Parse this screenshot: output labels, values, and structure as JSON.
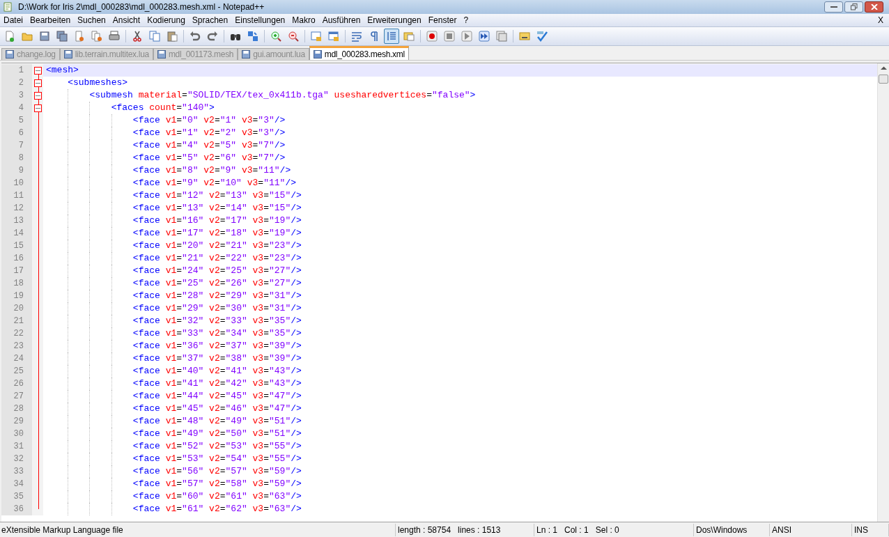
{
  "window": {
    "title": "D:\\Work for Iris 2\\mdl_000283\\mdl_000283.mesh.xml - Notepad++"
  },
  "menu": [
    "Datei",
    "Bearbeiten",
    "Suchen",
    "Ansicht",
    "Kodierung",
    "Sprachen",
    "Einstellungen",
    "Makro",
    "Ausführen",
    "Erweiterungen",
    "Fenster",
    "?"
  ],
  "menu_close": "X",
  "toolbar": [
    {
      "kind": "new"
    },
    {
      "kind": "open"
    },
    {
      "kind": "save"
    },
    {
      "kind": "saveall"
    },
    {
      "kind": "close"
    },
    {
      "kind": "closeall"
    },
    {
      "kind": "print"
    },
    {
      "kind": "sep"
    },
    {
      "kind": "cut"
    },
    {
      "kind": "copy"
    },
    {
      "kind": "paste"
    },
    {
      "kind": "sep"
    },
    {
      "kind": "undo"
    },
    {
      "kind": "redo"
    },
    {
      "kind": "sep"
    },
    {
      "kind": "find"
    },
    {
      "kind": "replace"
    },
    {
      "kind": "sep"
    },
    {
      "kind": "zoomin"
    },
    {
      "kind": "zoomout"
    },
    {
      "kind": "sep"
    },
    {
      "kind": "syncv"
    },
    {
      "kind": "synch"
    },
    {
      "kind": "sep"
    },
    {
      "kind": "wrap",
      "pressed": false
    },
    {
      "kind": "pilcrow",
      "pressed": false
    },
    {
      "kind": "indent",
      "pressed": true
    },
    {
      "kind": "folder",
      "pressed": false
    },
    {
      "kind": "sep"
    },
    {
      "kind": "record"
    },
    {
      "kind": "stop"
    },
    {
      "kind": "play"
    },
    {
      "kind": "playmulti"
    },
    {
      "kind": "savemacro"
    },
    {
      "kind": "sep"
    },
    {
      "kind": "link"
    },
    {
      "kind": "spell"
    }
  ],
  "tabs": [
    {
      "label": "change.log",
      "selected": false
    },
    {
      "label": "lib.terrain.multitex.lua",
      "selected": false
    },
    {
      "label": "mdl_001173.mesh",
      "selected": false
    },
    {
      "label": "gui.amount.lua",
      "selected": false
    },
    {
      "label": "mdl_000283.mesh.xml",
      "selected": true
    }
  ],
  "editor": {
    "lines": [
      {
        "number": "1",
        "text": "<mesh>",
        "expanded": true,
        "current": true
      },
      {
        "number": "2",
        "text": "    <submeshes>",
        "expanded": true,
        "current": false
      },
      {
        "number": "3",
        "text": "        <submesh material=\"SOLID/TEX/tex_0x411b.tga\" usesharedvertices=\"false\">",
        "expanded": true,
        "current": false
      },
      {
        "number": "4",
        "text": "            <faces count=\"140\">",
        "expanded": true,
        "current": false
      },
      {
        "number": "5",
        "text": "                <face v1=\"0\" v2=\"1\" v3=\"3\"/>",
        "current": false
      },
      {
        "number": "6",
        "text": "                <face v1=\"1\" v2=\"2\" v3=\"3\"/>",
        "current": false
      },
      {
        "number": "7",
        "text": "                <face v1=\"4\" v2=\"5\" v3=\"7\"/>",
        "current": false
      },
      {
        "number": "8",
        "text": "                <face v1=\"5\" v2=\"6\" v3=\"7\"/>",
        "current": false
      },
      {
        "number": "9",
        "text": "                <face v1=\"8\" v2=\"9\" v3=\"11\"/>",
        "current": false
      },
      {
        "number": "10",
        "text": "                <face v1=\"9\" v2=\"10\" v3=\"11\"/>",
        "current": false
      },
      {
        "number": "11",
        "text": "                <face v1=\"12\" v2=\"13\" v3=\"15\"/>",
        "current": false
      },
      {
        "number": "12",
        "text": "                <face v1=\"13\" v2=\"14\" v3=\"15\"/>",
        "current": false
      },
      {
        "number": "13",
        "text": "                <face v1=\"16\" v2=\"17\" v3=\"19\"/>",
        "current": false
      },
      {
        "number": "14",
        "text": "                <face v1=\"17\" v2=\"18\" v3=\"19\"/>",
        "current": false
      },
      {
        "number": "15",
        "text": "                <face v1=\"20\" v2=\"21\" v3=\"23\"/>",
        "current": false
      },
      {
        "number": "16",
        "text": "                <face v1=\"21\" v2=\"22\" v3=\"23\"/>",
        "current": false
      },
      {
        "number": "17",
        "text": "                <face v1=\"24\" v2=\"25\" v3=\"27\"/>",
        "current": false
      },
      {
        "number": "18",
        "text": "                <face v1=\"25\" v2=\"26\" v3=\"27\"/>",
        "current": false
      },
      {
        "number": "19",
        "text": "                <face v1=\"28\" v2=\"29\" v3=\"31\"/>",
        "current": false
      },
      {
        "number": "20",
        "text": "                <face v1=\"29\" v2=\"30\" v3=\"31\"/>",
        "current": false
      },
      {
        "number": "21",
        "text": "                <face v1=\"32\" v2=\"33\" v3=\"35\"/>",
        "current": false
      },
      {
        "number": "22",
        "text": "                <face v1=\"33\" v2=\"34\" v3=\"35\"/>",
        "current": false
      },
      {
        "number": "23",
        "text": "                <face v1=\"36\" v2=\"37\" v3=\"39\"/>",
        "current": false
      },
      {
        "number": "24",
        "text": "                <face v1=\"37\" v2=\"38\" v3=\"39\"/>",
        "current": false
      },
      {
        "number": "25",
        "text": "                <face v1=\"40\" v2=\"41\" v3=\"43\"/>",
        "current": false
      },
      {
        "number": "26",
        "text": "                <face v1=\"41\" v2=\"42\" v3=\"43\"/>",
        "current": false
      },
      {
        "number": "27",
        "text": "                <face v1=\"44\" v2=\"45\" v3=\"47\"/>",
        "current": false
      },
      {
        "number": "28",
        "text": "                <face v1=\"45\" v2=\"46\" v3=\"47\"/>",
        "current": false
      },
      {
        "number": "29",
        "text": "                <face v1=\"48\" v2=\"49\" v3=\"51\"/>",
        "current": false
      },
      {
        "number": "30",
        "text": "                <face v1=\"49\" v2=\"50\" v3=\"51\"/>",
        "current": false
      },
      {
        "number": "31",
        "text": "                <face v1=\"52\" v2=\"53\" v3=\"55\"/>",
        "current": false
      },
      {
        "number": "32",
        "text": "                <face v1=\"53\" v2=\"54\" v3=\"55\"/>",
        "current": false
      },
      {
        "number": "33",
        "text": "                <face v1=\"56\" v2=\"57\" v3=\"59\"/>",
        "current": false
      },
      {
        "number": "34",
        "text": "                <face v1=\"57\" v2=\"58\" v3=\"59\"/>",
        "current": false
      },
      {
        "number": "35",
        "text": "                <face v1=\"60\" v2=\"61\" v3=\"63\"/>",
        "current": false
      },
      {
        "number": "36",
        "text": "                <face v1=\"61\" v2=\"62\" v3=\"63\"/>",
        "current": false
      }
    ]
  },
  "status_bar": {
    "file_type": "eXtensible Markup Language file",
    "length": "length : 58754",
    "lines": "lines : 1513",
    "ln": "Ln : 1",
    "col": "Col : 1",
    "sel": "Sel : 0",
    "eol": "Dos\\Windows",
    "encoding": "ANSI",
    "mode": "INS"
  }
}
